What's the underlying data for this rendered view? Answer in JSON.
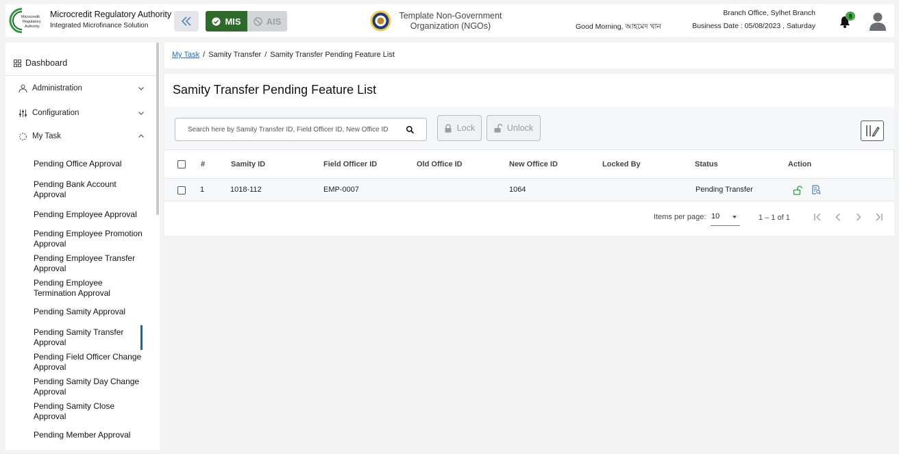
{
  "header": {
    "logo_text": "Microcredit Regulatory Authority",
    "brand_title": "Microcredit Regulatory Authority",
    "brand_subtitle": "Integrated Microfinance Solution",
    "modes": {
      "active": "MIS",
      "inactive": "AIS"
    },
    "org_line1": "Template Non-Government",
    "org_line2": "Organization (NGOs)",
    "greeting": "Good Morning, আহমেদ খান",
    "branch": "Branch Office, Sylhet Branch",
    "business_date": "Business Date : 05/08/2023 , Saturday",
    "notification_count": "8",
    "colors": {
      "mis": "#2e6b2a",
      "badge": "#3eab44",
      "accent": "#1f5fa6"
    }
  },
  "sidebar": {
    "dashboard": "Dashboard",
    "groups": [
      {
        "label": "Administration",
        "icon": "admin-icon",
        "expanded": false
      },
      {
        "label": "Configuration",
        "icon": "sliders-icon",
        "expanded": false
      },
      {
        "label": "My Task",
        "icon": "refresh-icon",
        "expanded": true
      }
    ],
    "items": [
      "Pending Office Approval",
      "Pending Bank Account Approval",
      "Pending Employee Approval",
      "Pending Employee Promotion Approval",
      "Pending Employee Transfer Approval",
      "Pending Employee Termination Approval",
      "Pending Samity Approval",
      "Pending Samity Transfer Approval",
      "Pending Field Officer Change Approval",
      "Pending Samity Day Change Approval",
      "Pending Samity Close Approval",
      "Pending Member Approval"
    ],
    "active_item": "Pending Samity Transfer Approval"
  },
  "breadcrumb": {
    "link": "My Task",
    "sep": "/",
    "mid": "Samity Transfer",
    "current": "Samity Transfer Pending Feature List"
  },
  "main": {
    "title": "Samity Transfer Pending Feature List",
    "search_placeholder": "Search here by Samity Transfer ID, Field Officer ID, New Office ID",
    "lock_label": "Lock",
    "unlock_label": "Unlock"
  },
  "table": {
    "headers": [
      "#",
      "Samity ID",
      "Field Officer ID",
      "Old Office ID",
      "New Office ID",
      "Locked By",
      "Status",
      "Action"
    ],
    "rows": [
      {
        "num": "1",
        "samity_id": "1018-112",
        "field_officer_id": "EMP-0007",
        "old_office_id": "",
        "new_office_id": "1064",
        "locked_by": "",
        "status": "Pending Transfer"
      }
    ]
  },
  "paginator": {
    "items_per_page_label": "Items per page:",
    "items_per_page": "10",
    "range": "1 – 1 of 1"
  }
}
